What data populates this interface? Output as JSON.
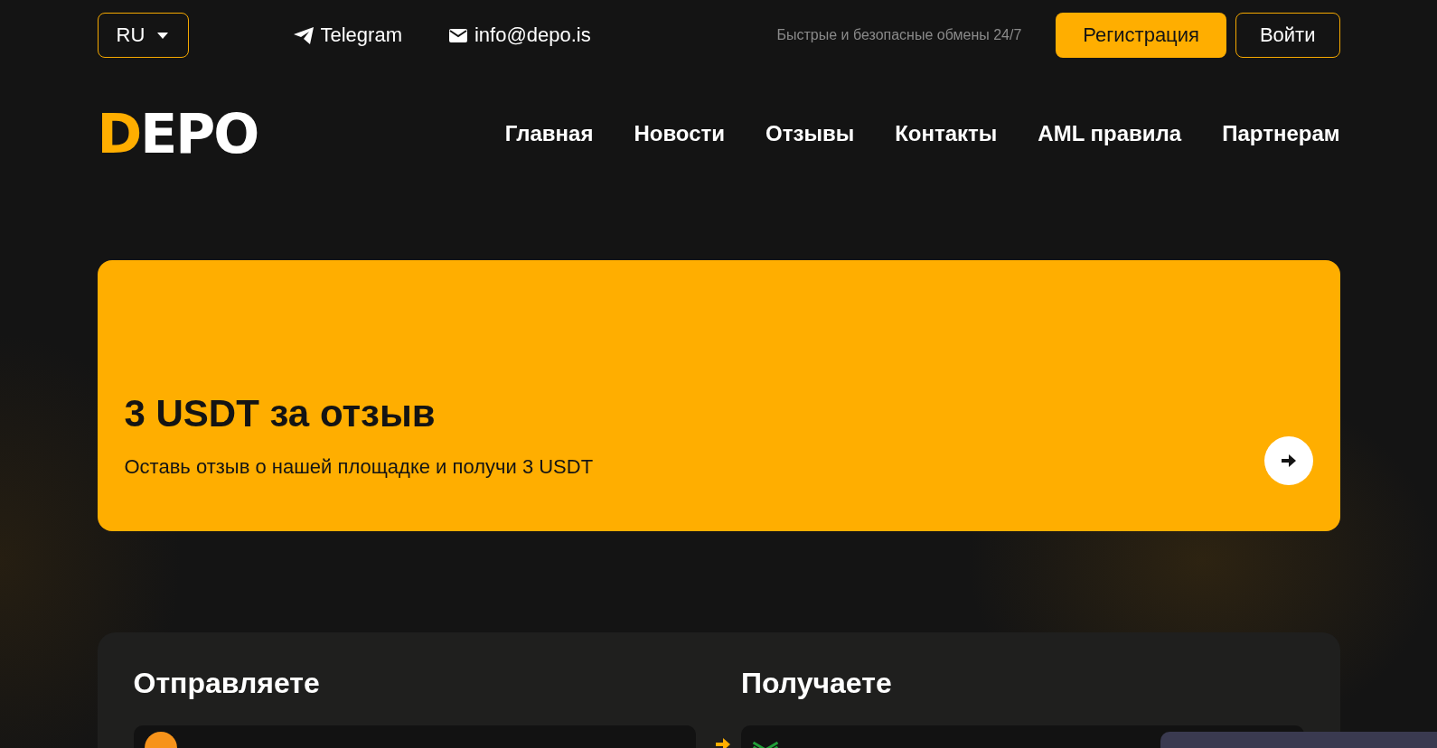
{
  "topbar": {
    "language": "RU",
    "telegram": "Telegram",
    "email": "info@depo.is",
    "tagline": "Быстрые и безопасные обмены 24/7",
    "register": "Регистрация",
    "login": "Войти"
  },
  "logo": {
    "first": "D",
    "rest": "EPO"
  },
  "nav": [
    {
      "label": "Главная"
    },
    {
      "label": "Новости"
    },
    {
      "label": "Отзывы"
    },
    {
      "label": "Контакты"
    },
    {
      "label": "AML правила"
    },
    {
      "label": "Партнерам"
    }
  ],
  "banner": {
    "title": "3 USDT за отзыв",
    "text": "Оставь отзыв о нашей площадке и получи 3 USDT"
  },
  "exchange": {
    "send": {
      "heading": "Отправляете"
    },
    "receive": {
      "heading": "Получаете"
    }
  }
}
